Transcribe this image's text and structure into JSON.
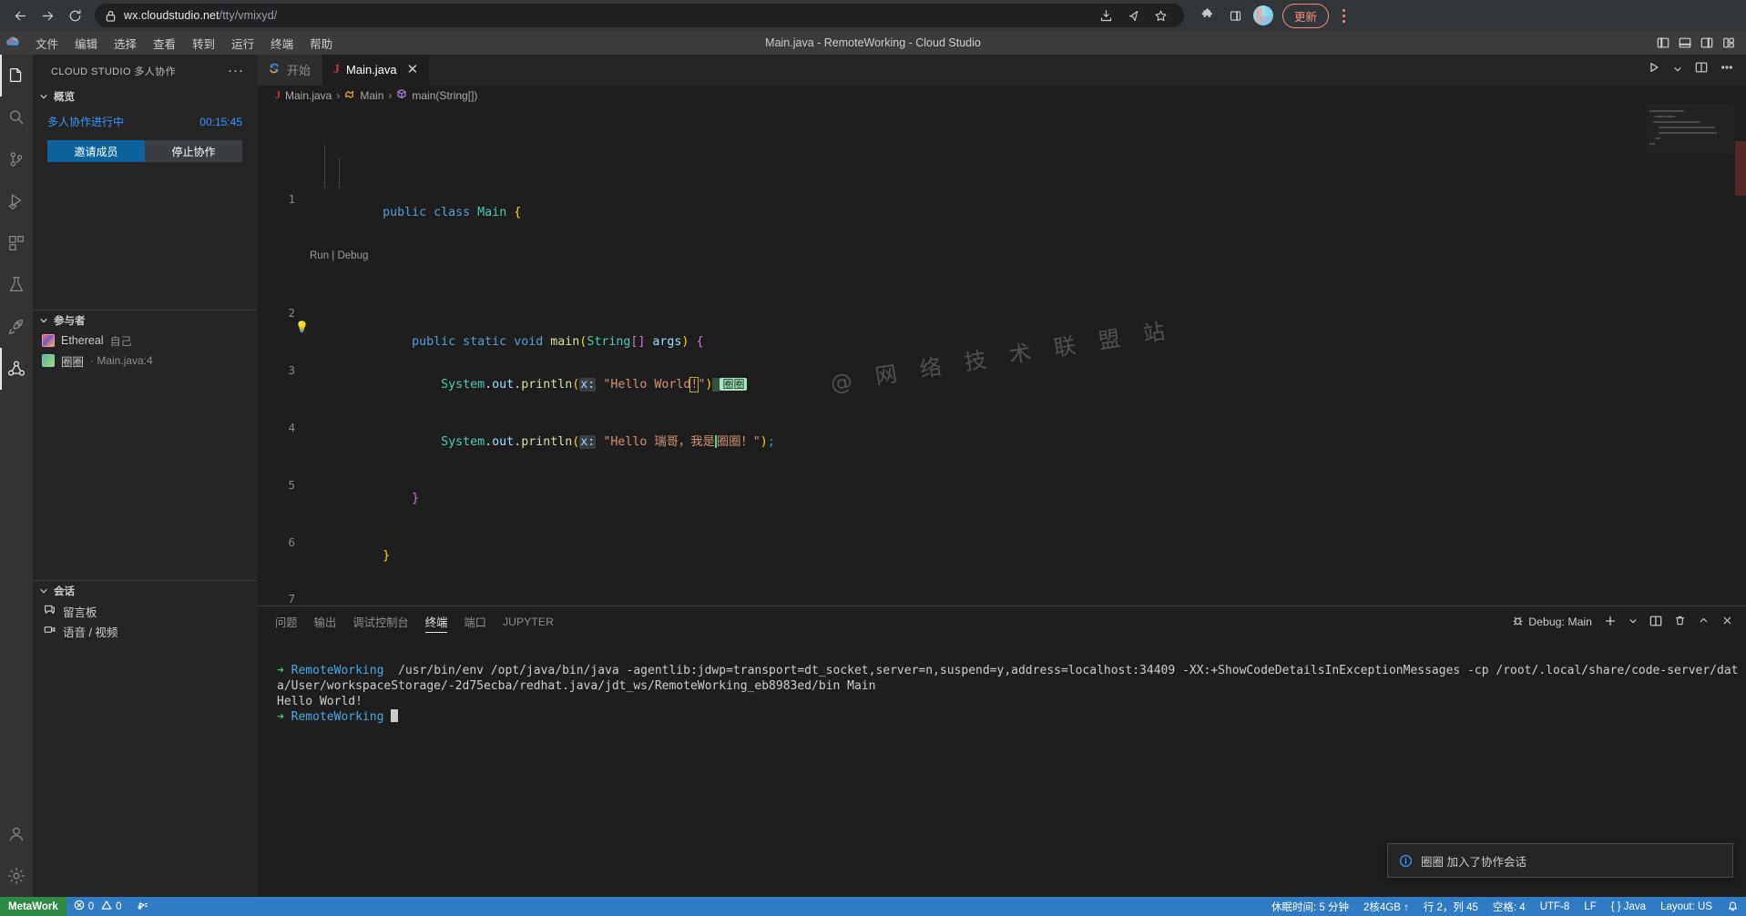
{
  "browser": {
    "url_host": "wx.cloudstudio.net",
    "url_path": "/tty/vmixyd/",
    "update_label": "更新",
    "icons": [
      "back-arrow-icon",
      "forward-arrow-icon",
      "reload-icon",
      "lock-icon",
      "install-icon",
      "share-icon",
      "bookmark-star-icon",
      "extensions-puzzle-icon",
      "side-panel-icon",
      "profile-avatar",
      "update-button",
      "browser-menu-kebab-icon"
    ]
  },
  "titlebar": {
    "menus": [
      "文件",
      "编辑",
      "选择",
      "查看",
      "转到",
      "运行",
      "终端",
      "帮助"
    ],
    "window_title": "Main.java - RemoteWorking - Cloud Studio",
    "layout_icons": [
      "toggle-primary-sidebar-icon",
      "toggle-panel-icon",
      "toggle-secondary-sidebar-icon",
      "customize-layout-icon"
    ]
  },
  "activitybar": {
    "items": [
      {
        "name": "explorer",
        "active": true
      },
      {
        "name": "search",
        "active": false
      },
      {
        "name": "source-control",
        "active": false
      },
      {
        "name": "run-and-debug",
        "active": false
      },
      {
        "name": "extensions",
        "active": false
      },
      {
        "name": "testing",
        "active": false
      },
      {
        "name": "remote-rocket",
        "active": false
      },
      {
        "name": "live-share",
        "active": true
      }
    ],
    "bottom": [
      {
        "name": "accounts"
      },
      {
        "name": "manage-settings"
      }
    ]
  },
  "sidebar": {
    "title": "CLOUD STUDIO 多人协作",
    "more_actions": "···",
    "overview": {
      "header": "概览",
      "status": "多人协作进行中",
      "timer": "00:15:45",
      "invite_button": "邀请成员",
      "stop_button": "停止协作"
    },
    "participants": {
      "header": "参与者",
      "items": [
        {
          "name": "Ethereal",
          "meta": "自己"
        },
        {
          "name": "圈圈",
          "meta": "· Main.java:4"
        }
      ]
    },
    "conversation": {
      "header": "会话",
      "items": [
        {
          "label": "留言板",
          "icon": "message-board-icon"
        },
        {
          "label": "语音 / 视频",
          "icon": "camera-icon"
        }
      ]
    }
  },
  "editor": {
    "tabs": [
      {
        "label": "开始",
        "icon": "cloudstudio-start-icon",
        "active": false,
        "closable": false
      },
      {
        "label": "Main.java",
        "icon": "java-icon",
        "active": true,
        "closable": true
      }
    ],
    "tab_actions": [
      "run-play-icon",
      "run-dropdown-chevron",
      "split-editor-icon",
      "editor-more-actions-icon"
    ],
    "breadcrumb": [
      "Main.java",
      "Main",
      "main(String[])"
    ],
    "codelens": "Run | Debug",
    "watermark": "@ 网 络 技 术 联 盟 站",
    "lines": [
      {
        "num": "1",
        "text": "public class Main {"
      },
      {
        "num": "2",
        "text": "    public static void main(String[] args) {"
      },
      {
        "num": "3",
        "text": "        System.out.println(x: \"Hello World!\")"
      },
      {
        "num": "4",
        "text": "        System.out.println(x: \"Hello 瑞哥，我是圈圈！\");"
      },
      {
        "num": "5",
        "text": "    }"
      },
      {
        "num": "6",
        "text": "}"
      },
      {
        "num": "7",
        "text": ""
      }
    ],
    "remote_cursor_badge": "圈圈",
    "param_hint": "x:"
  },
  "panel": {
    "tabs": [
      "问题",
      "输出",
      "调试控制台",
      "终端",
      "端口",
      "JUPYTER"
    ],
    "active_tab": "终端",
    "debug_label": "Debug: Main",
    "actions": [
      "debug-console-icon",
      "new-terminal-plus-icon",
      "terminal-profile-chevron",
      "split-terminal-icon",
      "kill-terminal-trash-icon",
      "maximize-panel-chevron-icon",
      "close-panel-x-icon"
    ],
    "terminal": {
      "prompt_arrow": "➜",
      "host": "RemoteWorking",
      "command": "/usr/bin/env /opt/java/bin/java -agentlib:jdwp=transport=dt_socket,server=n,suspend=y,address=localhost:34409 -XX:+ShowCodeDetailsInExceptionMessages -cp /root/.local/share/code-server/data/User/workspaceStorage/-2d75ecba/redhat.java/jdt_ws/RemoteWorking_eb8983ed/bin Main",
      "output": "Hello World!"
    }
  },
  "notification": {
    "icon": "info-circle-icon",
    "message": "圈圈 加入了协作会话"
  },
  "statusbar": {
    "left": [
      {
        "name": "remote-host",
        "label": "MetaWork"
      },
      {
        "name": "problems",
        "label": "0  0",
        "errors": "0",
        "warnings": "0"
      },
      {
        "name": "ports-forwarded",
        "label": ""
      }
    ],
    "right": [
      {
        "name": "idle-time",
        "label": "休眠时间: 5 分钟"
      },
      {
        "name": "machine-spec",
        "label": "2核4GB ↑"
      },
      {
        "name": "cursor-position",
        "label": "行 2，列 45"
      },
      {
        "name": "indentation",
        "label": "空格: 4"
      },
      {
        "name": "encoding",
        "label": "UTF-8"
      },
      {
        "name": "eol",
        "label": "LF"
      },
      {
        "name": "language-mode",
        "label": "{ } Java"
      },
      {
        "name": "keyboard-layout",
        "label": "Layout: US"
      },
      {
        "name": "notifications-bell",
        "label": ""
      }
    ]
  },
  "colors": {
    "accent_blue": "#0e639c",
    "status_bar": "#2f7bc4",
    "remote_green": "#2f8a43",
    "cursor_green": "#4ad17c",
    "link_blue": "#3794ff",
    "update_red": "#f28b82"
  }
}
